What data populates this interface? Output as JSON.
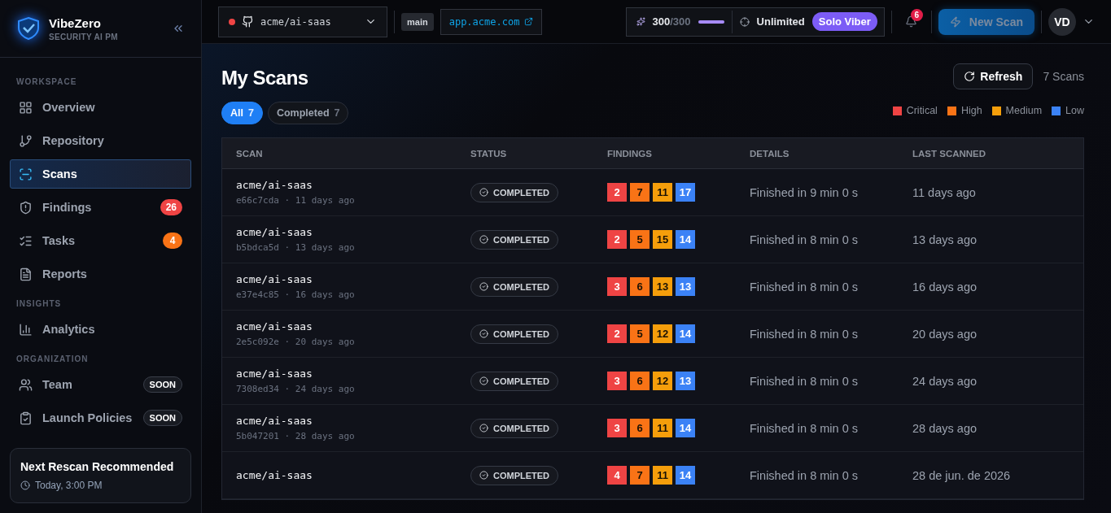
{
  "brand": {
    "name": "VibeZero",
    "tagline": "SECURITY AI PM"
  },
  "sidebar": {
    "sections": [
      {
        "title": "WORKSPACE",
        "items": [
          {
            "label": "Overview",
            "selected": false
          },
          {
            "label": "Repository",
            "selected": false
          },
          {
            "label": "Scans",
            "selected": true
          },
          {
            "label": "Findings",
            "selected": false,
            "badge": {
              "text": "26",
              "color": "#ef4444"
            }
          },
          {
            "label": "Tasks",
            "selected": false,
            "badge": {
              "text": "4",
              "color": "#f97316"
            }
          },
          {
            "label": "Reports",
            "selected": false
          }
        ]
      },
      {
        "title": "INSIGHTS",
        "items": [
          {
            "label": "Analytics",
            "selected": false
          }
        ]
      },
      {
        "title": "ORGANIZATION",
        "items": [
          {
            "label": "Team",
            "selected": false,
            "tag": "SOON"
          },
          {
            "label": "Launch Policies",
            "selected": false,
            "tag": "SOON"
          }
        ]
      }
    ],
    "card": {
      "title": "Next Rescan Recommended",
      "time": "Today, 3:00 PM"
    }
  },
  "topbar": {
    "repo": "acme/ai-saas",
    "branch": "main",
    "url": "app.acme.com",
    "credits_used": "300",
    "credits_total": "/300",
    "credits": {
      "level": 1
    },
    "plan_limit": "Unlimited",
    "plan": "Solo Viber",
    "notifications": "6",
    "new_scan": "New Scan",
    "avatar": "VD"
  },
  "page": {
    "title": "My Scans",
    "refresh": "Refresh",
    "count": "7 Scans",
    "filters": [
      {
        "label": "All",
        "count": "7",
        "selected": true
      },
      {
        "label": "Completed",
        "count": "7",
        "selected": false
      }
    ],
    "legend": [
      {
        "label": "Critical",
        "color": "#ef4444"
      },
      {
        "label": "High",
        "color": "#f97316"
      },
      {
        "label": "Medium",
        "color": "#f59e0b"
      },
      {
        "label": "Low",
        "color": "#3b82f6"
      }
    ]
  },
  "table": {
    "columns": [
      "SCAN",
      "STATUS",
      "FINDINGS",
      "DETAILS",
      "LAST SCANNED"
    ],
    "rows": [
      {
        "name": "acme/ai-saas",
        "sub": "e66c7cda · 11 days ago",
        "status": "COMPLETED",
        "findings": [
          "2",
          "7",
          "11",
          "17"
        ],
        "details": "Finished in 9 min 0 s",
        "last": "11 days ago"
      },
      {
        "name": "acme/ai-saas",
        "sub": "b5bdca5d · 13 days ago",
        "status": "COMPLETED",
        "findings": [
          "2",
          "5",
          "15",
          "14"
        ],
        "details": "Finished in 8 min 0 s",
        "last": "13 days ago"
      },
      {
        "name": "acme/ai-saas",
        "sub": "e37e4c85 · 16 days ago",
        "status": "COMPLETED",
        "findings": [
          "3",
          "6",
          "13",
          "13"
        ],
        "details": "Finished in 8 min 0 s",
        "last": "16 days ago"
      },
      {
        "name": "acme/ai-saas",
        "sub": "2e5c092e · 20 days ago",
        "status": "COMPLETED",
        "findings": [
          "2",
          "5",
          "12",
          "14"
        ],
        "details": "Finished in 8 min 0 s",
        "last": "20 days ago"
      },
      {
        "name": "acme/ai-saas",
        "sub": "7308ed34 · 24 days ago",
        "status": "COMPLETED",
        "findings": [
          "3",
          "6",
          "12",
          "13"
        ],
        "details": "Finished in 8 min 0 s",
        "last": "24 days ago"
      },
      {
        "name": "acme/ai-saas",
        "sub": "5b047201 · 28 days ago",
        "status": "COMPLETED",
        "findings": [
          "3",
          "6",
          "11",
          "14"
        ],
        "details": "Finished in 8 min 0 s",
        "last": "28 days ago"
      },
      {
        "name": "acme/ai-saas",
        "status": "COMPLETED",
        "findings": [
          "4",
          "7",
          "11",
          "14"
        ],
        "details": "Finished in 8 min 0 s",
        "last": "28 de jun. de 2026"
      }
    ]
  }
}
